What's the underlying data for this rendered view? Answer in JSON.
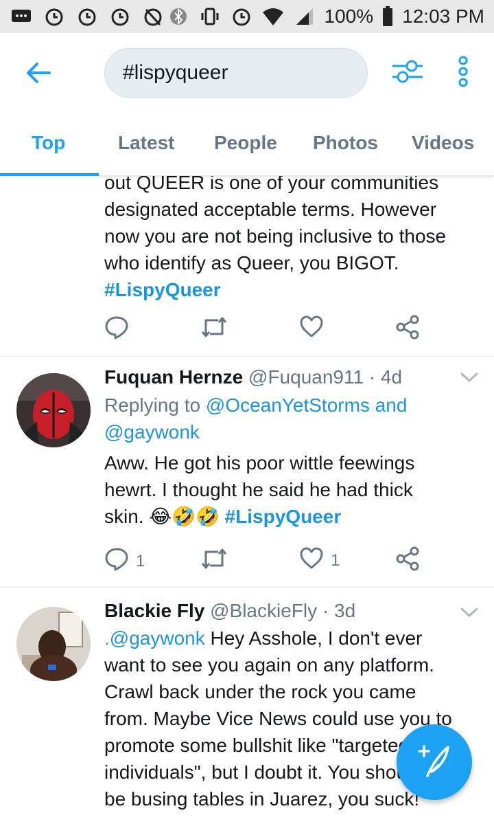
{
  "status_bar": {
    "battery": "100%",
    "time": "12:03 PM"
  },
  "search": {
    "query": "#lispyqueer"
  },
  "tabs": [
    {
      "label": "Top"
    },
    {
      "label": "Latest"
    },
    {
      "label": "People"
    },
    {
      "label": "Photos"
    },
    {
      "label": "Videos"
    }
  ],
  "tweets": [
    {
      "lines": [
        "out QUEER is one of your communities",
        "designated acceptable terms. However",
        "now you are not being inclusive to those",
        "who identify as Queer, you BIGOT."
      ],
      "hashtag": "#LispyQueer"
    },
    {
      "name": "Fuquan Hernze",
      "handle": "@Fuquan911",
      "time": "· 4d",
      "replying_prefix": "Replying to",
      "replying_to_1": "@OceanYetStorms and",
      "replying_to_2": "@gaywonk",
      "lines": [
        "Aww. He got his poor wittle feewings",
        "hewrt. I thought he said he had thick"
      ],
      "last_line_text": "skin.",
      "emoji": "😂🤣🤣",
      "hashtag": "#LispyQueer",
      "reply_count": "1",
      "like_count": "1"
    },
    {
      "name": "Blackie Fly",
      "handle": "@BlackieFly",
      "time": "· 3d",
      "mention": ".@gaywonk",
      "first_line_rest": " Hey Asshole, I don't ever",
      "lines": [
        "want to see you again on any platform.",
        "Crawl back under the rock you came",
        "from. Maybe Vice News could use you to",
        "promote some bullshit like \"targeted",
        "individuals\", but I doubt it. You should",
        "be busing tables in Juarez, you suck!"
      ]
    }
  ],
  "colors": {
    "accent": "#1da1f2",
    "link": "#1b95e0",
    "muted": "#657786"
  },
  "icons": {
    "back": "arrow-left",
    "filter": "sliders",
    "more": "vertical-dots",
    "reply": "speech-bubble",
    "retweet": "retweet-arrows",
    "like": "heart",
    "share": "share-nodes",
    "compose": "feather-plus"
  }
}
